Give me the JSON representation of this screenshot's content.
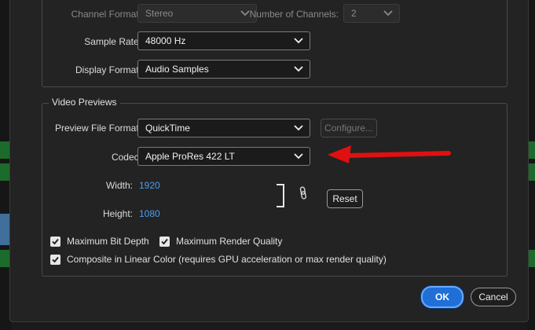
{
  "audio": {
    "channel_format_label": "Channel Format:",
    "channel_format_value": "Stereo",
    "num_channels_label": "Number of Channels:",
    "num_channels_value": "2",
    "sample_rate_label": "Sample Rate:",
    "sample_rate_value": "48000 Hz",
    "display_format_label": "Display Format:",
    "display_format_value": "Audio Samples"
  },
  "video_previews": {
    "group_title": "Video Previews",
    "preview_file_format_label": "Preview File Format:",
    "preview_file_format_value": "QuickTime",
    "configure_label": "Configure...",
    "codec_label": "Codec:",
    "codec_value": "Apple ProRes 422 LT",
    "width_label": "Width:",
    "width_value": "1920",
    "height_label": "Height:",
    "height_value": "1080",
    "reset_label": "Reset",
    "max_bit_depth_label": "Maximum Bit Depth",
    "max_bit_depth_checked": true,
    "max_render_quality_label": "Maximum Render Quality",
    "max_render_quality_checked": true,
    "composite_linear_label": "Composite in Linear Color (requires GPU acceleration or max render quality)",
    "composite_linear_checked": true
  },
  "footer": {
    "ok_label": "OK",
    "cancel_label": "Cancel"
  },
  "colors": {
    "annotation_arrow": "#e01010",
    "accent": "#1f6fd6",
    "link_value": "#4b9cf5"
  }
}
